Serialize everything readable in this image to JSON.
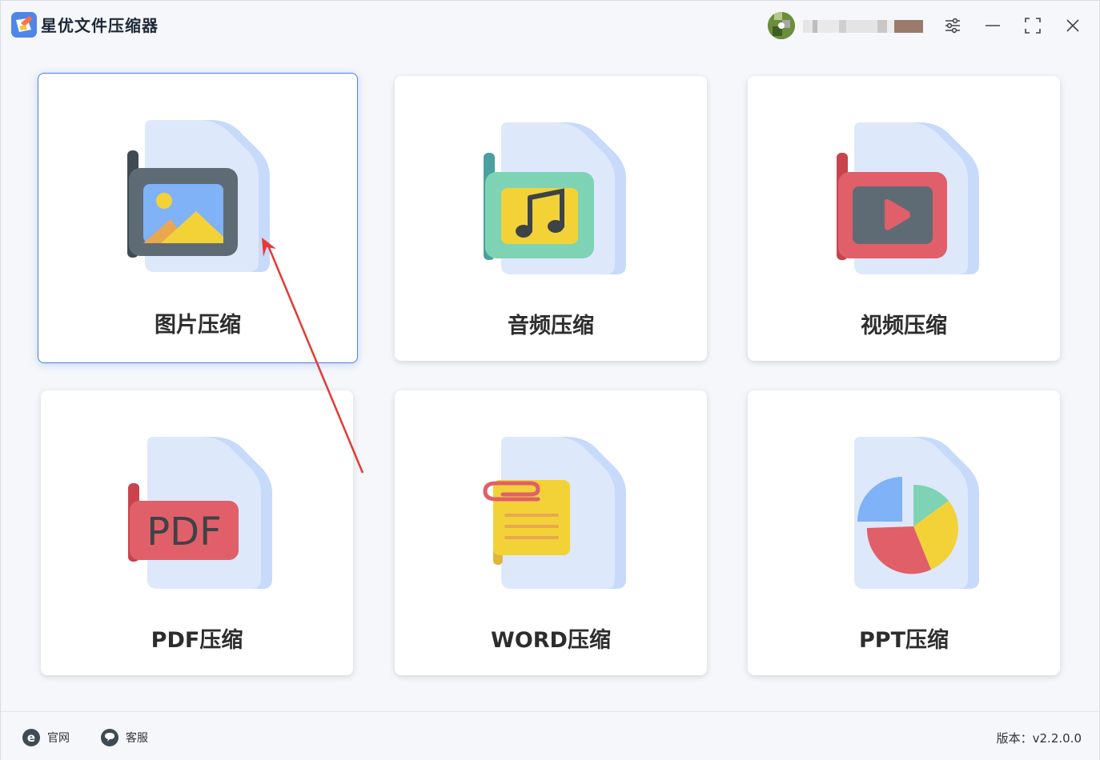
{
  "app": {
    "title": "星优文件压缩器"
  },
  "cards": [
    {
      "label": "图片压缩",
      "icon": "image-file-icon",
      "active": true
    },
    {
      "label": "音频压缩",
      "icon": "audio-file-icon",
      "active": false
    },
    {
      "label": "视频压缩",
      "icon": "video-file-icon",
      "active": false
    },
    {
      "label": "PDF压缩",
      "icon": "pdf-file-icon",
      "active": false
    },
    {
      "label": "WORD压缩",
      "icon": "word-file-icon",
      "active": false
    },
    {
      "label": "PPT压缩",
      "icon": "ppt-file-icon",
      "active": false
    }
  ],
  "footer": {
    "website_label": "官网",
    "support_label": "客服",
    "version": "版本：v2.2.0.0"
  },
  "colors": {
    "accent": "#4f7fe6",
    "arrow": "#e53935",
    "card_bg": "#ffffff",
    "window_bg": "#f5f7fb"
  }
}
